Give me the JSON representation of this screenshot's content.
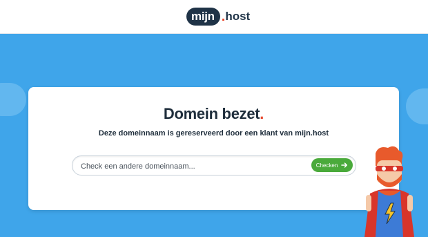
{
  "header": {
    "logo": {
      "text_main": "mijn",
      "dot": ".",
      "text_suffix": "host"
    }
  },
  "card": {
    "title": "Domein bezet",
    "title_dot": ".",
    "subtitle": "Deze domeinnaam is gereserveerd door een klant van mijn.host"
  },
  "search": {
    "placeholder": "Check een andere domeinnaam...",
    "value": "",
    "button_label": "Checken",
    "button_icon": "arrow-right-icon"
  },
  "colors": {
    "background": "#3fa5ea",
    "brand_dark": "#1f3347",
    "accent_red": "#e8492e",
    "button_green": "#4aaa3b"
  },
  "mascot": {
    "icon": "superhero-mascot-icon"
  }
}
